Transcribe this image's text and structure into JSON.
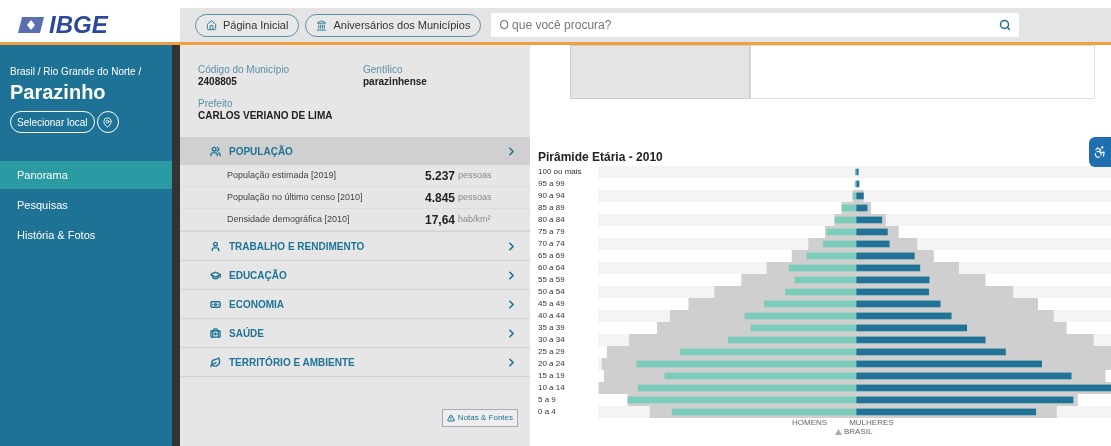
{
  "header": {
    "logo": "IBGE",
    "nav": [
      {
        "label": "Página Inicial"
      },
      {
        "label": "Aniversários dos Municípios"
      }
    ],
    "search": {
      "placeholder": "O que você procura?"
    }
  },
  "sidebar": {
    "breadcrumb": "Brasil / Rio Grande do Norte /",
    "city": "Parazinho",
    "select_button": "Selecionar local",
    "items": [
      {
        "label": "Panorama",
        "selected": true
      },
      {
        "label": "Pesquisas",
        "selected": false
      },
      {
        "label": "História & Fotos",
        "selected": false
      }
    ]
  },
  "info": {
    "fields": [
      {
        "label": "Código do Município",
        "value": "2408805"
      },
      {
        "label": "Gentílico",
        "value": "parazinhense"
      },
      {
        "label": "Prefeito",
        "value": "CARLOS VERIANO DE LIMA"
      }
    ]
  },
  "sections": [
    {
      "title": "POPULAÇÃO",
      "expanded": true,
      "rows": [
        {
          "label": "População estimada [2019]",
          "value": "5.237",
          "unit": "pessoas"
        },
        {
          "label": "População no último censo [2010]",
          "value": "4.845",
          "unit": "pessoas"
        },
        {
          "label": "Densidade demográfica [2010]",
          "value": "17,64",
          "unit": "hab/km²"
        }
      ]
    },
    {
      "title": "TRABALHO E RENDIMENTO",
      "expanded": false
    },
    {
      "title": "EDUCAÇÃO",
      "expanded": false
    },
    {
      "title": "ECONOMIA",
      "expanded": false
    },
    {
      "title": "SAÚDE",
      "expanded": false
    },
    {
      "title": "TERRITÓRIO E AMBIENTE",
      "expanded": false
    }
  ],
  "notes_button": "Notas & Fontes",
  "chart": {
    "title": "Pirâmide Etária - 2010",
    "age_groups": [
      "100 ou mais",
      "95 a 99",
      "90 a 94",
      "85 a 89",
      "80 a 84",
      "75 a 79",
      "70 a 74",
      "65 a 69",
      "60 a 64",
      "55 a 59",
      "50 a 54",
      "45 a 49",
      "40 a 44",
      "35 a 39",
      "30 a 34",
      "25 a 29",
      "20 a 24",
      "15 a 19",
      "10 a 14",
      "5 a 9",
      "0 a 4"
    ],
    "legend": [
      "HOMENS",
      "MULHERES"
    ],
    "reference": "BRASIL"
  }
}
